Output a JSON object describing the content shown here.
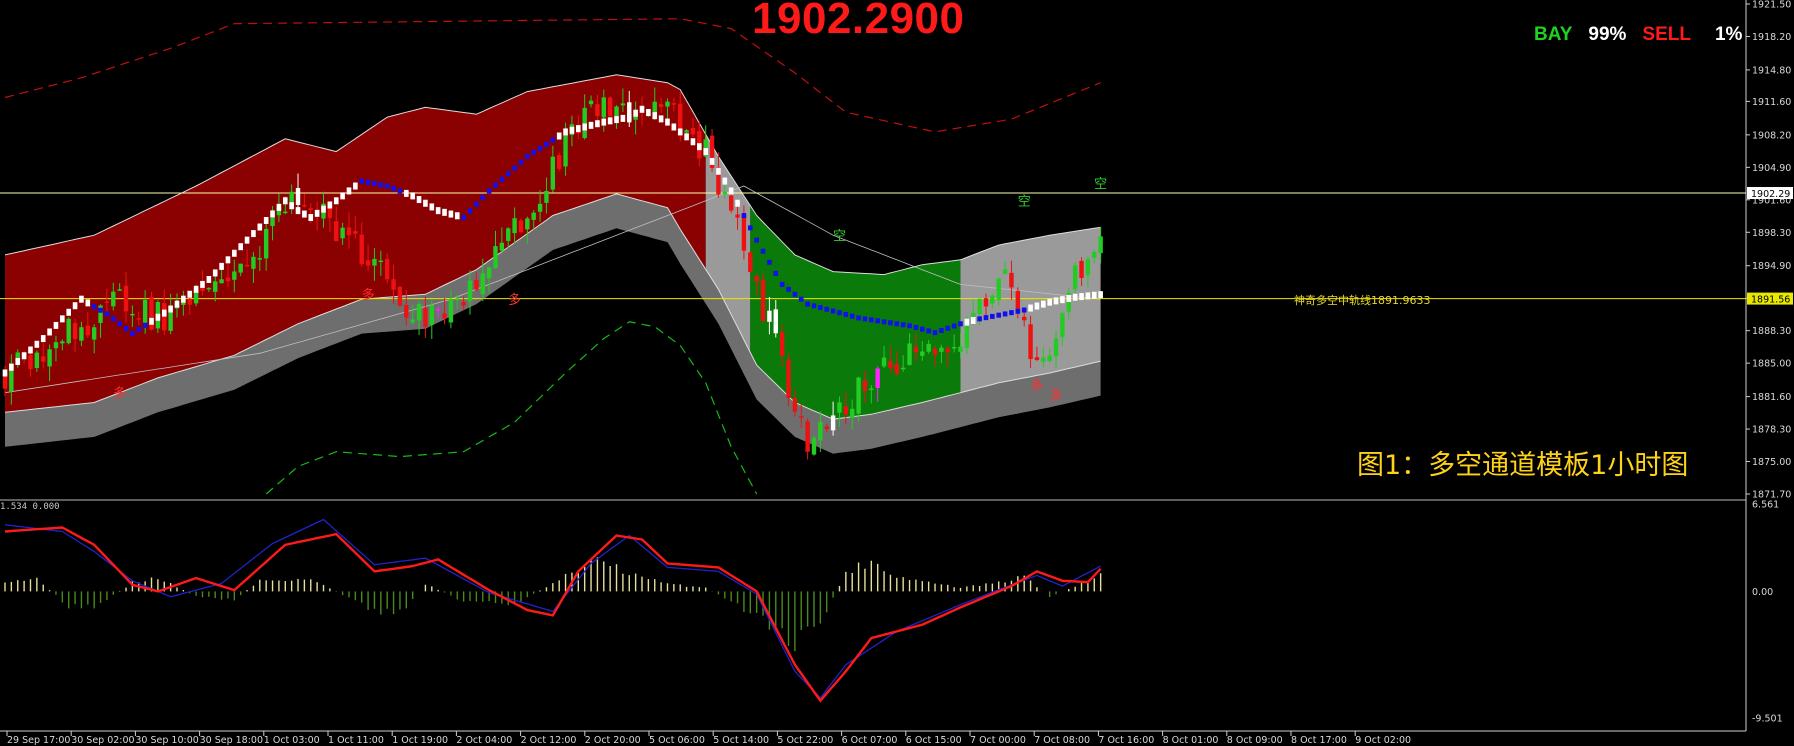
{
  "header": {
    "current_price": "1902.2900",
    "buy_label": "BAY",
    "buy_pct": "99%",
    "sell_label": "SELL",
    "sell_pct": "1%"
  },
  "caption": "图1：多空通道模板1小时图",
  "midline_label": "神奇多空中轨线1891.9633",
  "signal_glyph": "多",
  "macd_header": "1.534 0.000",
  "colors": {
    "background": "#000000",
    "bull_candle": "#22cc22",
    "bear_candle": "#ee1111",
    "bull_channel": "#8b0000",
    "bear_channel": "#0a7a0a",
    "neutral_channel": "#9a9a9a",
    "lower_band_shadow": "#6e6e6e",
    "trend_up": "#ffffff",
    "trend_down": "#1010ee",
    "macd_fast": "#ff1a1a",
    "macd_slow": "#2222cc",
    "hist_pos": "#e8e09a",
    "hist_neg": "#4a8a1a",
    "price_line": "#e8e800",
    "current_line": "#ffffaa"
  },
  "chart_data": [
    {
      "type": "candlestick",
      "panel": "price",
      "ylim": [
        1871.7,
        1921.5
      ],
      "y_ticks": [
        "1921.50",
        "1918.20",
        "1914.80",
        "1911.60",
        "1908.20",
        "1904.90",
        "1901.60",
        "1898.30",
        "1894.90",
        "1891.60",
        "1888.30",
        "1885.00",
        "1881.60",
        "1878.30",
        "1875.00",
        "1871.70"
      ],
      "current_price_marker": "1902.29",
      "mid_price_marker": "1891.56",
      "x_ticks": [
        "29 Sep 17:00",
        "30 Sep 02:00",
        "30 Sep 10:00",
        "30 Sep 18:00",
        "1 Oct 03:00",
        "1 Oct 11:00",
        "1 Oct 19:00",
        "2 Oct 04:00",
        "2 Oct 12:00",
        "2 Oct 20:00",
        "5 Oct 06:00",
        "5 Oct 14:00",
        "5 Oct 22:00",
        "6 Oct 07:00",
        "6 Oct 15:00",
        "7 Oct 00:00",
        "7 Oct 08:00",
        "7 Oct 16:00",
        "8 Oct 01:00",
        "8 Oct 09:00",
        "8 Oct 17:00",
        "9 Oct 02:00"
      ],
      "close_path": [
        [
          0,
          1884.0
        ],
        [
          6,
          1886.5
        ],
        [
          12,
          1888.8
        ],
        [
          18,
          1891.3
        ],
        [
          22,
          1890.0
        ],
        [
          26,
          1889.4
        ],
        [
          32,
          1892.5
        ],
        [
          38,
          1895.8
        ],
        [
          42,
          1898.5
        ],
        [
          46,
          1902.0
        ],
        [
          48,
          1901.4
        ],
        [
          52,
          1898.9
        ],
        [
          56,
          1896.0
        ],
        [
          60,
          1893.5
        ],
        [
          64,
          1890.4
        ],
        [
          68,
          1889.5
        ],
        [
          72,
          1891.5
        ],
        [
          78,
          1896.5
        ],
        [
          84,
          1902.5
        ],
        [
          88,
          1906.8
        ],
        [
          92,
          1910.3
        ],
        [
          94,
          1911.5
        ],
        [
          98,
          1910.0
        ],
        [
          102,
          1911.4
        ],
        [
          106,
          1909.5
        ],
        [
          110,
          1906.5
        ],
        [
          114,
          1900.5
        ],
        [
          118,
          1893.0
        ],
        [
          122,
          1884.5
        ],
        [
          126,
          1876.5
        ],
        [
          130,
          1878.6
        ],
        [
          134,
          1882.5
        ],
        [
          138,
          1884.8
        ],
        [
          142,
          1885.8
        ],
        [
          146,
          1886.0
        ],
        [
          150,
          1887.0
        ],
        [
          153,
          1890.0
        ],
        [
          157,
          1893.5
        ],
        [
          160,
          1888.5
        ],
        [
          163,
          1884.0
        ],
        [
          166,
          1891.0
        ],
        [
          170,
          1896.5
        ],
        [
          172,
          1898.8
        ]
      ],
      "trend_line": [
        [
          0,
          1884.0
        ],
        [
          6,
          1887.5
        ],
        [
          12,
          1891.5
        ],
        [
          16,
          1890.0
        ],
        [
          20,
          1888.0
        ],
        [
          26,
          1890.5
        ],
        [
          32,
          1893.5
        ],
        [
          38,
          1897.5
        ],
        [
          44,
          1901.5
        ],
        [
          46,
          1900.5
        ],
        [
          48,
          1899.8
        ],
        [
          52,
          1901.5
        ],
        [
          56,
          1903.5
        ],
        [
          60,
          1903.0
        ],
        [
          64,
          1902.0
        ],
        [
          68,
          1900.5
        ],
        [
          72,
          1899.8
        ],
        [
          76,
          1902.5
        ],
        [
          82,
          1906.0
        ],
        [
          88,
          1908.5
        ],
        [
          94,
          1909.5
        ],
        [
          98,
          1910.0
        ],
        [
          100,
          1910.8
        ],
        [
          104,
          1909.5
        ],
        [
          106,
          1908.5
        ],
        [
          110,
          1906.5
        ],
        [
          114,
          1902.5
        ],
        [
          118,
          1897.5
        ],
        [
          122,
          1893.0
        ],
        [
          126,
          1891.0
        ],
        [
          130,
          1890.3
        ],
        [
          134,
          1889.6
        ],
        [
          138,
          1889.2
        ],
        [
          142,
          1888.8
        ],
        [
          146,
          1888.1
        ],
        [
          150,
          1889.0
        ],
        [
          153,
          1889.5
        ],
        [
          157,
          1890.0
        ],
        [
          160,
          1890.4
        ],
        [
          164,
          1891.2
        ],
        [
          168,
          1891.7
        ],
        [
          172,
          1891.96
        ]
      ],
      "channel_upper": [
        [
          0,
          1896.0
        ],
        [
          14,
          1898.0
        ],
        [
          30,
          1903.0
        ],
        [
          44,
          1907.8
        ],
        [
          52,
          1906.5
        ],
        [
          60,
          1910.0
        ],
        [
          66,
          1911.0
        ],
        [
          74,
          1910.3
        ],
        [
          82,
          1912.6
        ],
        [
          96,
          1914.3
        ],
        [
          104,
          1913.5
        ],
        [
          106,
          1912.8
        ],
        [
          112,
          1906.0
        ],
        [
          118,
          1900.0
        ],
        [
          124,
          1896.0
        ],
        [
          130,
          1894.3
        ],
        [
          138,
          1894.0
        ],
        [
          144,
          1895.0
        ],
        [
          150,
          1895.5
        ],
        [
          156,
          1897.0
        ],
        [
          164,
          1898.0
        ],
        [
          172,
          1898.8
        ]
      ],
      "channel_lower": [
        [
          0,
          1880.0
        ],
        [
          14,
          1881.0
        ],
        [
          24,
          1883.5
        ],
        [
          36,
          1885.8
        ],
        [
          46,
          1889.0
        ],
        [
          56,
          1891.5
        ],
        [
          66,
          1892.0
        ],
        [
          74,
          1894.5
        ],
        [
          86,
          1900.0
        ],
        [
          96,
          1902.2
        ],
        [
          104,
          1900.8
        ],
        [
          106,
          1898.6
        ],
        [
          112,
          1892.5
        ],
        [
          118,
          1884.8
        ],
        [
          124,
          1881.0
        ],
        [
          130,
          1879.3
        ],
        [
          136,
          1879.8
        ],
        [
          144,
          1881.0
        ],
        [
          150,
          1882.0
        ],
        [
          156,
          1883.0
        ],
        [
          164,
          1884.0
        ],
        [
          172,
          1885.2
        ]
      ],
      "channel_shadow_shift": -3.5,
      "outer_upper": [
        [
          0,
          1912.0
        ],
        [
          12,
          1914.0
        ],
        [
          26,
          1917.0
        ],
        [
          36,
          1919.5
        ],
        [
          106,
          1920.0
        ],
        [
          114,
          1919.0
        ],
        [
          124,
          1914.5
        ],
        [
          132,
          1910.5
        ],
        [
          146,
          1908.5
        ],
        [
          158,
          1909.8
        ],
        [
          172,
          1913.5
        ]
      ],
      "outer_lower": [
        [
          41,
          1871.7
        ],
        [
          46,
          1874.5
        ],
        [
          52,
          1876.0
        ],
        [
          62,
          1875.5
        ],
        [
          72,
          1876.0
        ],
        [
          80,
          1879.0
        ],
        [
          88,
          1884.0
        ],
        [
          94,
          1887.5
        ],
        [
          98,
          1889.2
        ],
        [
          102,
          1888.7
        ],
        [
          106,
          1886.8
        ],
        [
          110,
          1883.0
        ],
        [
          114,
          1876.5
        ],
        [
          118,
          1871.7
        ]
      ],
      "slow_ma": [
        [
          0,
          1882.0
        ],
        [
          40,
          1886.0
        ],
        [
          70,
          1891.5
        ],
        [
          100,
          1899.0
        ],
        [
          116,
          1903.0
        ],
        [
          130,
          1898.0
        ],
        [
          150,
          1893.0
        ],
        [
          172,
          1891.5
        ]
      ],
      "regimes": [
        [
          0,
          110,
          "bull"
        ],
        [
          110,
          117,
          "neutral"
        ],
        [
          117,
          150,
          "bear"
        ],
        [
          150,
          172,
          "neutral"
        ]
      ],
      "down_segments": [
        [
          14,
          22
        ],
        [
          56,
          62
        ],
        [
          72,
          86
        ],
        [
          116,
          150
        ],
        [
          153,
          160
        ]
      ],
      "signal_marks": [
        [
          18,
          1881.5,
          "多"
        ],
        [
          57,
          1891.5,
          "多"
        ],
        [
          80,
          1891.0,
          "多"
        ],
        [
          131,
          1897.5,
          "空"
        ],
        [
          160,
          1901.0,
          "空"
        ],
        [
          162,
          1882.3,
          "多"
        ],
        [
          165,
          1881.3,
          "多"
        ],
        [
          172,
          1902.8,
          "空"
        ]
      ]
    },
    {
      "type": "macd",
      "panel": "oscillator",
      "ylim": [
        -9.501,
        6.561
      ],
      "y_ticks": [
        "6.561",
        "0.00",
        "-9.501"
      ],
      "fast_line": [
        [
          0,
          4.5
        ],
        [
          9,
          4.8
        ],
        [
          14,
          3.5
        ],
        [
          20,
          0.5
        ],
        [
          24,
          0.0
        ],
        [
          30,
          1.0
        ],
        [
          36,
          0.1
        ],
        [
          44,
          3.5
        ],
        [
          52,
          4.3
        ],
        [
          58,
          1.5
        ],
        [
          64,
          1.9
        ],
        [
          68,
          2.4
        ],
        [
          76,
          0.1
        ],
        [
          82,
          -1.4
        ],
        [
          86,
          -1.8
        ],
        [
          90,
          1.5
        ],
        [
          96,
          4.2
        ],
        [
          100,
          3.9
        ],
        [
          104,
          2.1
        ],
        [
          112,
          1.8
        ],
        [
          118,
          0.0
        ],
        [
          124,
          -5.5
        ],
        [
          128,
          -8.2
        ],
        [
          132,
          -6.0
        ],
        [
          136,
          -3.5
        ],
        [
          144,
          -2.5
        ],
        [
          150,
          -1.2
        ],
        [
          158,
          0.4
        ],
        [
          162,
          1.5
        ],
        [
          166,
          0.8
        ],
        [
          170,
          0.7
        ],
        [
          172,
          1.7
        ]
      ],
      "slow_line": [
        [
          0,
          5.0
        ],
        [
          9,
          4.5
        ],
        [
          14,
          3.0
        ],
        [
          20,
          0.8
        ],
        [
          26,
          -0.4
        ],
        [
          34,
          0.6
        ],
        [
          42,
          3.6
        ],
        [
          50,
          5.4
        ],
        [
          58,
          2.0
        ],
        [
          66,
          2.5
        ],
        [
          76,
          -0.1
        ],
        [
          86,
          -1.5
        ],
        [
          92,
          2.1
        ],
        [
          98,
          4.2
        ],
        [
          104,
          1.8
        ],
        [
          112,
          1.5
        ],
        [
          118,
          -0.2
        ],
        [
          124,
          -6.0
        ],
        [
          128,
          -8.0
        ],
        [
          132,
          -5.5
        ],
        [
          140,
          -3.0
        ],
        [
          150,
          -1.0
        ],
        [
          158,
          0.5
        ],
        [
          162,
          1.2
        ],
        [
          166,
          0.4
        ],
        [
          172,
          1.9
        ]
      ],
      "histogram_envelope": [
        [
          0,
          0.9
        ],
        [
          5,
          1.0
        ],
        [
          10,
          -1.2
        ],
        [
          14,
          -1.3
        ],
        [
          20,
          0.7
        ],
        [
          24,
          1.1
        ],
        [
          30,
          -0.4
        ],
        [
          36,
          -0.7
        ],
        [
          40,
          0.9
        ],
        [
          48,
          1.0
        ],
        [
          58,
          -1.6
        ],
        [
          62,
          -1.8
        ],
        [
          66,
          0.6
        ],
        [
          72,
          -0.8
        ],
        [
          80,
          -1.0
        ],
        [
          86,
          0.6
        ],
        [
          90,
          1.8
        ],
        [
          94,
          2.6
        ],
        [
          98,
          1.4
        ],
        [
          104,
          0.6
        ],
        [
          110,
          0.3
        ],
        [
          118,
          -2.0
        ],
        [
          124,
          -4.3
        ],
        [
          128,
          -2.5
        ],
        [
          132,
          1.5
        ],
        [
          136,
          2.5
        ],
        [
          140,
          1.2
        ],
        [
          150,
          0.3
        ],
        [
          156,
          0.7
        ],
        [
          160,
          1.2
        ],
        [
          164,
          -0.4
        ],
        [
          168,
          0.4
        ],
        [
          172,
          1.3
        ]
      ]
    }
  ]
}
